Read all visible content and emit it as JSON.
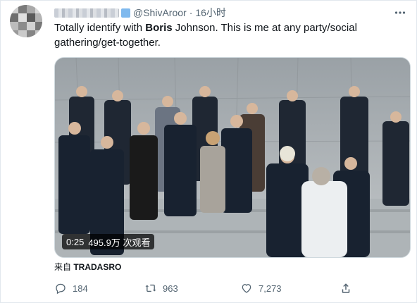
{
  "tweet": {
    "handle": "@ShivAroor",
    "separator": "·",
    "time": "16小时",
    "text_before": "Totally identify with ",
    "text_bold": "Boris",
    "text_after": " Johnson. This is me at any party/social gathering/get-together.",
    "more_icon": "more-icon"
  },
  "media": {
    "duration": "0:25",
    "views": "495.9万 次观看"
  },
  "source": {
    "prefix": "来自 ",
    "name": "TRADASRO"
  },
  "actions": {
    "reply_count": "184",
    "retweet_count": "963",
    "like_count": "7,273"
  },
  "colors": {
    "text": "#0f1419",
    "secondary": "#536471",
    "border": "#cfd9de"
  }
}
